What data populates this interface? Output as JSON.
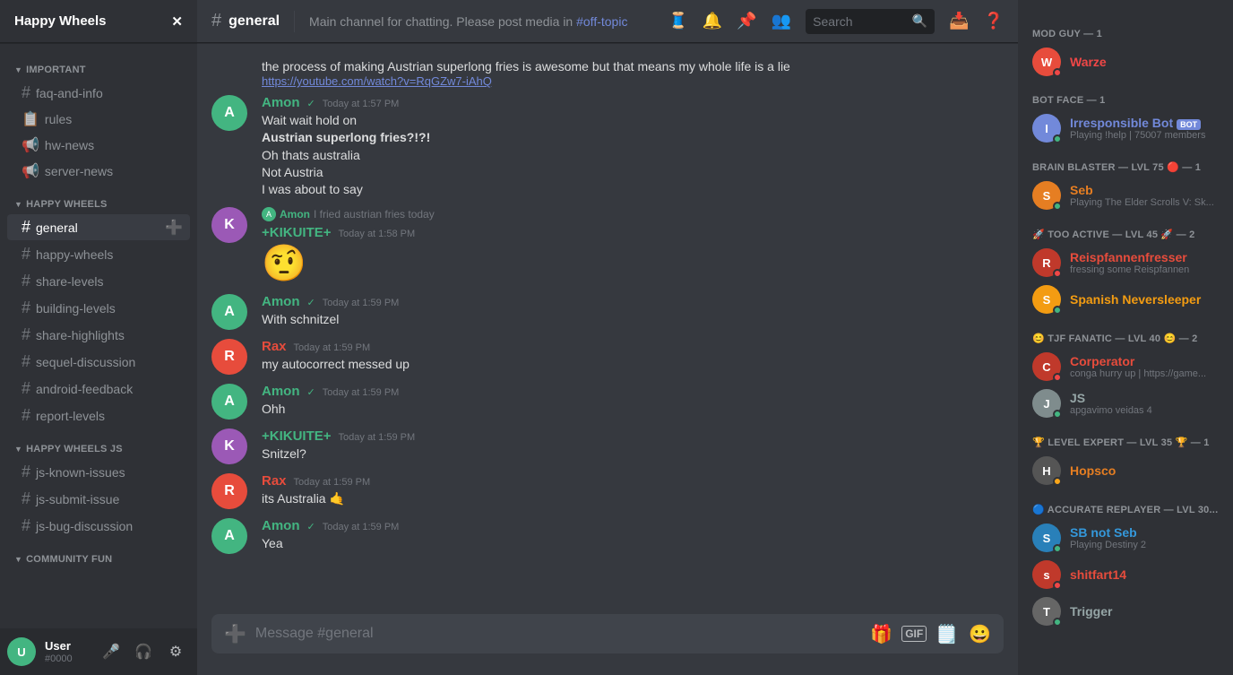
{
  "server": {
    "name": "Happy Wheels",
    "icon_emoji": "🚲",
    "checkmark_icon": "✓"
  },
  "header": {
    "channel": "general",
    "hash": "#",
    "topic": "Main channel for chatting. Please post media in",
    "topic_link": "#off-topic",
    "topic_link_text": "#off-topic"
  },
  "search": {
    "placeholder": "Search",
    "value": ""
  },
  "sidebar": {
    "sections": [
      {
        "name": "IMPORTANT",
        "channels": [
          {
            "id": "faq-and-info",
            "label": "faq-and-info",
            "icon": "#",
            "type": "text"
          },
          {
            "id": "rules",
            "label": "rules",
            "icon": "📋",
            "type": "text"
          },
          {
            "id": "hw-news",
            "label": "hw-news",
            "icon": "📢",
            "type": "text"
          },
          {
            "id": "server-news",
            "label": "server-news",
            "icon": "📢",
            "type": "text"
          }
        ]
      },
      {
        "name": "HAPPY WHEELS",
        "channels": [
          {
            "id": "general",
            "label": "general",
            "icon": "#",
            "type": "text",
            "active": true
          },
          {
            "id": "happy-wheels",
            "label": "happy-wheels",
            "icon": "#",
            "type": "text"
          },
          {
            "id": "share-levels",
            "label": "share-levels",
            "icon": "#",
            "type": "text"
          },
          {
            "id": "building-levels",
            "label": "building-levels",
            "icon": "#",
            "type": "text"
          },
          {
            "id": "share-highlights",
            "label": "share-highlights",
            "icon": "#",
            "type": "text"
          },
          {
            "id": "sequel-discussion",
            "label": "sequel-discussion",
            "icon": "#",
            "type": "text"
          },
          {
            "id": "android-feedback",
            "label": "android-feedback",
            "icon": "#",
            "type": "text"
          },
          {
            "id": "report-levels",
            "label": "report-levels",
            "icon": "#",
            "type": "text"
          }
        ]
      },
      {
        "name": "HAPPY WHEELS JS",
        "channels": [
          {
            "id": "js-known-issues",
            "label": "js-known-issues",
            "icon": "#",
            "type": "text"
          },
          {
            "id": "js-submit-issue",
            "label": "js-submit-issue",
            "icon": "#",
            "type": "text"
          },
          {
            "id": "js-bug-discussion",
            "label": "js-bug-discussion",
            "icon": "#",
            "type": "text"
          }
        ]
      },
      {
        "name": "COMMUNITY FUN",
        "channels": []
      }
    ]
  },
  "messages": [
    {
      "id": "msg-prev",
      "type": "continuation",
      "text": "the process of making Austrian superlong fries is awesome but that means my whole life is a lie",
      "link": "https://youtube.com/watch?v=RqGZw7-iAhQ",
      "link_text": "https://youtube.com/watch?v=RqGZw7-iAhQ"
    },
    {
      "id": "msg-1",
      "type": "group",
      "author": "Amon",
      "author_color": "#43b581",
      "checkmark": "✓",
      "timestamp": "Today at 1:57 PM",
      "avatar_color": "#43b581",
      "avatar_letter": "A",
      "lines": [
        {
          "type": "text",
          "content": "Wait wait hold on"
        },
        {
          "type": "text",
          "content": "Austrian superlong fries?!?!",
          "bold": true
        },
        {
          "type": "text",
          "content": "Oh thats australia"
        },
        {
          "type": "text",
          "content": "Not Austria"
        },
        {
          "type": "text",
          "content": "I was about to say"
        }
      ]
    },
    {
      "id": "msg-2",
      "type": "group",
      "author": "+KIKUITE+",
      "author_color": "#43b581",
      "timestamp": "Today at 1:58 PM",
      "avatar_color": "#9b59b6",
      "avatar_letter": "K",
      "reply": {
        "author": "Amon",
        "author_color": "#43b581",
        "text": "I fried austrian fries today"
      },
      "lines": [
        {
          "type": "emoji",
          "content": "🤨"
        }
      ]
    },
    {
      "id": "msg-3",
      "type": "group",
      "author": "Amon",
      "author_color": "#43b581",
      "checkmark": "✓",
      "timestamp": "Today at 1:59 PM",
      "avatar_color": "#43b581",
      "avatar_letter": "A",
      "lines": [
        {
          "type": "text",
          "content": "With schnitzel"
        }
      ]
    },
    {
      "id": "msg-4",
      "type": "group",
      "author": "Rax",
      "author_color": "#e74c3c",
      "timestamp": "Today at 1:59 PM",
      "avatar_color": "#e74c3c",
      "avatar_letter": "R",
      "lines": [
        {
          "type": "text",
          "content": "my autocorrect messed up"
        }
      ]
    },
    {
      "id": "msg-5",
      "type": "group",
      "author": "Amon",
      "author_color": "#43b581",
      "checkmark": "✓",
      "timestamp": "Today at 1:59 PM",
      "avatar_color": "#43b581",
      "avatar_letter": "A",
      "lines": [
        {
          "type": "text",
          "content": "Ohh"
        }
      ]
    },
    {
      "id": "msg-6",
      "type": "group",
      "author": "+KIKUITE+",
      "author_color": "#43b581",
      "timestamp": "Today at 1:59 PM",
      "avatar_color": "#9b59b6",
      "avatar_letter": "K",
      "lines": [
        {
          "type": "text",
          "content": "Snitzel?"
        }
      ]
    },
    {
      "id": "msg-7",
      "type": "group",
      "author": "Rax",
      "author_color": "#e74c3c",
      "timestamp": "Today at 1:59 PM",
      "avatar_color": "#e74c3c",
      "avatar_letter": "R",
      "lines": [
        {
          "type": "text",
          "content": "its Australia 🤙"
        }
      ]
    },
    {
      "id": "msg-8",
      "type": "group",
      "author": "Amon",
      "author_color": "#43b581",
      "checkmark": "✓",
      "timestamp": "Today at 1:59 PM",
      "avatar_color": "#43b581",
      "avatar_letter": "A",
      "lines": [
        {
          "type": "text",
          "content": "Yea"
        }
      ]
    }
  ],
  "chat_input": {
    "placeholder": "Message #general"
  },
  "right_sidebar": {
    "sections": [
      {
        "label": "MOD GUY — 1",
        "members": [
          {
            "name": "Warze",
            "color": "#f04747",
            "status": "dnd",
            "activity": "",
            "badge": "diamond",
            "avatar_bg": "#e74c3c",
            "avatar_letter": "W"
          }
        ]
      },
      {
        "label": "BOT FACE — 1",
        "members": [
          {
            "name": "Irresponsible Bot",
            "color": "#7289da",
            "is_bot": true,
            "status": "online",
            "activity": "Playing !help | 75007 members",
            "avatar_bg": "#7289da",
            "avatar_letter": "I"
          }
        ]
      },
      {
        "label": "BRAIN BLASTER — LVL 75 🔴 — 1",
        "members": [
          {
            "name": "Seb",
            "color": "#e67e22",
            "status": "online",
            "activity": "Playing The Elder Scrolls V: Sk...",
            "avatar_bg": "#e67e22",
            "avatar_letter": "S",
            "badge": "diamond"
          }
        ]
      },
      {
        "label": "🚀 TOO ACTIVE — LVL 45 🚀 — 2",
        "members": [
          {
            "name": "Reispfannenfresser",
            "color": "#e74c3c",
            "status": "dnd",
            "activity": "fressing some Reispfannen",
            "avatar_bg": "#c0392b",
            "avatar_letter": "R"
          },
          {
            "name": "Spanish Neversleeper",
            "color": "#f39c12",
            "status": "online",
            "activity": "",
            "avatar_bg": "#f39c12",
            "avatar_letter": "S"
          }
        ]
      },
      {
        "label": "😊 TJF FANATIC — LVL 40 😊 — 2",
        "members": [
          {
            "name": "Corperator",
            "color": "#e74c3c",
            "status": "dnd",
            "activity": "conga hurry up | https://game...",
            "avatar_bg": "#c0392b",
            "avatar_letter": "C"
          },
          {
            "name": "JS",
            "color": "#95a5a6",
            "status": "online",
            "activity": "apgavimo veidas 4",
            "avatar_bg": "#7f8c8d",
            "avatar_letter": "J"
          }
        ]
      },
      {
        "label": "🏆 LEVEL EXPERT — LVL 35 🏆 — 1",
        "members": [
          {
            "name": "Hopsco",
            "color": "#e67e22",
            "status": "idle",
            "activity": "",
            "avatar_bg": "#555",
            "avatar_letter": "H",
            "badge": "diamond"
          }
        ]
      },
      {
        "label": "🔵 ACCURATE REPLAYER — LVL 30...",
        "members": [
          {
            "name": "SB not Seb",
            "color": "#3498db",
            "status": "online",
            "activity": "Playing Destiny 2",
            "avatar_bg": "#2980b9",
            "avatar_letter": "S"
          },
          {
            "name": "shitfart14",
            "color": "#e74c3c",
            "status": "dnd",
            "activity": "",
            "avatar_bg": "#c0392b",
            "avatar_letter": "s",
            "badge": "diamond"
          },
          {
            "name": "Trigger",
            "color": "#95a5a6",
            "status": "online",
            "activity": "",
            "avatar_bg": "#666",
            "avatar_letter": "T"
          }
        ]
      }
    ]
  },
  "bottom_icons": [
    {
      "name": "microphone-slash-icon",
      "symbol": "🎤",
      "label": "Mute"
    },
    {
      "name": "headset-slash-icon",
      "symbol": "🎧",
      "label": "Deafen"
    },
    {
      "name": "settings-icon",
      "symbol": "⚙",
      "label": "Settings"
    }
  ]
}
